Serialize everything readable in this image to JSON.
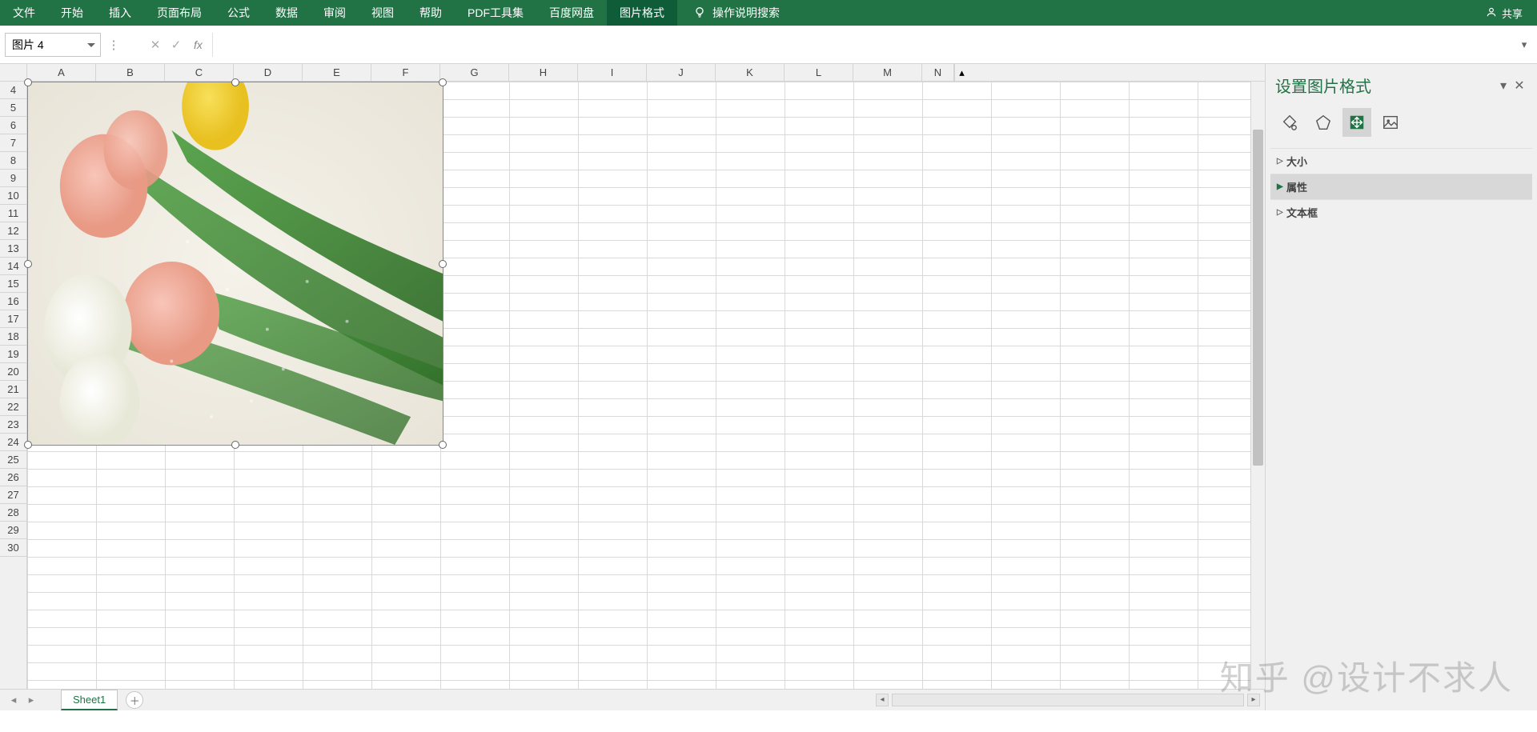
{
  "ribbon": {
    "tabs": [
      "文件",
      "开始",
      "插入",
      "页面布局",
      "公式",
      "数据",
      "审阅",
      "视图",
      "帮助",
      "PDF工具集",
      "百度网盘",
      "图片格式"
    ],
    "active_tab": "图片格式",
    "tell_me": "操作说明搜索",
    "share": "共享"
  },
  "formula_bar": {
    "name_box": "图片 4",
    "fx_label": "fx",
    "value": ""
  },
  "grid": {
    "columns": [
      "A",
      "B",
      "C",
      "D",
      "E",
      "F",
      "G",
      "H",
      "I",
      "J",
      "K",
      "L",
      "M",
      "N"
    ],
    "row_start": 4,
    "row_end": 30
  },
  "picture": {
    "name": "图片 4",
    "description": "tulip flowers (pink, yellow, white) photo"
  },
  "sheet_tabs": {
    "active": "Sheet1",
    "tabs": [
      "Sheet1"
    ]
  },
  "side_pane": {
    "title": "设置图片格式",
    "tabs": [
      "fill-line",
      "effects",
      "size-properties",
      "picture"
    ],
    "active_tab": "size-properties",
    "sections": {
      "size": "大小",
      "props": "属性",
      "textbox": "文本框"
    },
    "selected_section": "props"
  },
  "watermark": "知乎 @设计不求人"
}
